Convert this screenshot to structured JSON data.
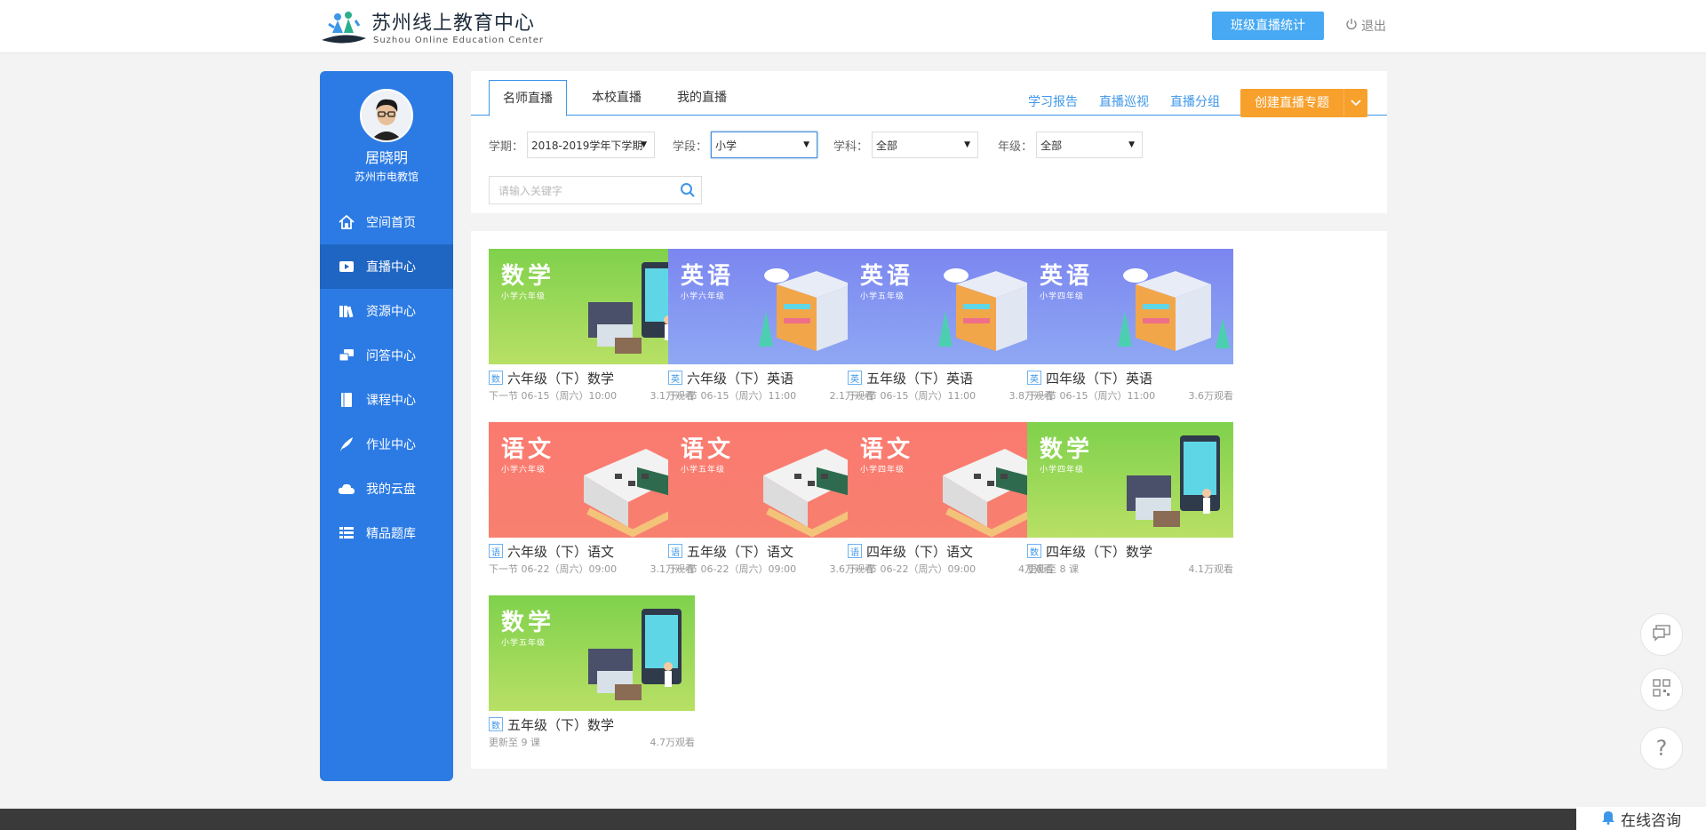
{
  "header": {
    "logo_title": "苏州线上教育中心",
    "logo_subtitle": "Suzhou  Online  Education  Center",
    "class_live_stats": "班级直播统计",
    "logout": "退出"
  },
  "sidebar": {
    "user_name": "居晓明",
    "user_org": "苏州市电教馆",
    "items": [
      {
        "label": "空间首页",
        "icon": "home-icon",
        "active": false
      },
      {
        "label": "直播中心",
        "icon": "play-icon",
        "active": true
      },
      {
        "label": "资源中心",
        "icon": "books-icon",
        "active": false
      },
      {
        "label": "问答中心",
        "icon": "chat-icon",
        "active": false
      },
      {
        "label": "课程中心",
        "icon": "book-icon",
        "active": false
      },
      {
        "label": "作业中心",
        "icon": "feather-icon",
        "active": false
      },
      {
        "label": "我的云盘",
        "icon": "cloud-icon",
        "active": false
      },
      {
        "label": "精品题库",
        "icon": "list-icon",
        "active": false
      }
    ]
  },
  "tabs": [
    "名师直播",
    "本校直播",
    "我的直播"
  ],
  "top_links": [
    "学习报告",
    "直播巡视",
    "直播分组"
  ],
  "create_button": "创建直播专题",
  "filters": {
    "term_label": "学期：",
    "term_value": "2018-2019学年下学期",
    "stage_label": "学段：",
    "stage_value": "小学",
    "subject_label": "学科：",
    "subject_value": "全部",
    "grade_label": "年级：",
    "grade_value": "全部"
  },
  "search": {
    "placeholder": "请输入关键字"
  },
  "colors": {
    "primary": "#2c7be4",
    "accent_blue": "#47a9f3",
    "orange": "#f7a02c",
    "math_thumb": "#8ad25a",
    "english_thumb": "#7d8ff0",
    "chinese_thumb": "#f7776e"
  },
  "courses": [
    {
      "tag": "数",
      "title": "六年级（下）数学",
      "meta": "下一节 06-15（周六）10:00",
      "views": "3.1万观看",
      "thumb_subject": "数学",
      "thumb_grade": "小学六年级",
      "theme": "math"
    },
    {
      "tag": "英",
      "title": "六年级（下）英语",
      "meta": "下一节 06-15（周六）11:00",
      "views": "2.1万观看",
      "thumb_subject": "英语",
      "thumb_grade": "小学六年级",
      "theme": "english"
    },
    {
      "tag": "英",
      "title": "五年级（下）英语",
      "meta": "下一节 06-15（周六）11:00",
      "views": "3.8万观看",
      "thumb_subject": "英语",
      "thumb_grade": "小学五年级",
      "theme": "english"
    },
    {
      "tag": "英",
      "title": "四年级（下）英语",
      "meta": "下一节 06-15（周六）11:00",
      "views": "3.6万观看",
      "thumb_subject": "英语",
      "thumb_grade": "小学四年级",
      "theme": "english"
    },
    {
      "tag": "语",
      "title": "六年级（下）语文",
      "meta": "下一节 06-22（周六）09:00",
      "views": "3.1万观看",
      "thumb_subject": "语文",
      "thumb_grade": "小学六年级",
      "theme": "chinese"
    },
    {
      "tag": "语",
      "title": "五年级（下）语文",
      "meta": "下一节 06-22（周六）09:00",
      "views": "3.6万观看",
      "thumb_subject": "语文",
      "thumb_grade": "小学五年级",
      "theme": "chinese"
    },
    {
      "tag": "语",
      "title": "四年级（下）语文",
      "meta": "下一节 06-22（周六）09:00",
      "views": "4万观看",
      "thumb_subject": "语文",
      "thumb_grade": "小学四年级",
      "theme": "chinese"
    },
    {
      "tag": "数",
      "title": "四年级（下）数学",
      "meta": "更新至 8 课",
      "views": "4.1万观看",
      "thumb_subject": "数学",
      "thumb_grade": "小学四年级",
      "theme": "math"
    },
    {
      "tag": "数",
      "title": "五年级（下）数学",
      "meta": "更新至 9 课",
      "views": "4.7万观看",
      "thumb_subject": "数学",
      "thumb_grade": "小学五年级",
      "theme": "math"
    }
  ],
  "float_tools": [
    {
      "icon": "feedback-icon"
    },
    {
      "icon": "qrcode-icon"
    },
    {
      "icon": "help-icon",
      "label": "?"
    }
  ],
  "consult": "在线咨询"
}
